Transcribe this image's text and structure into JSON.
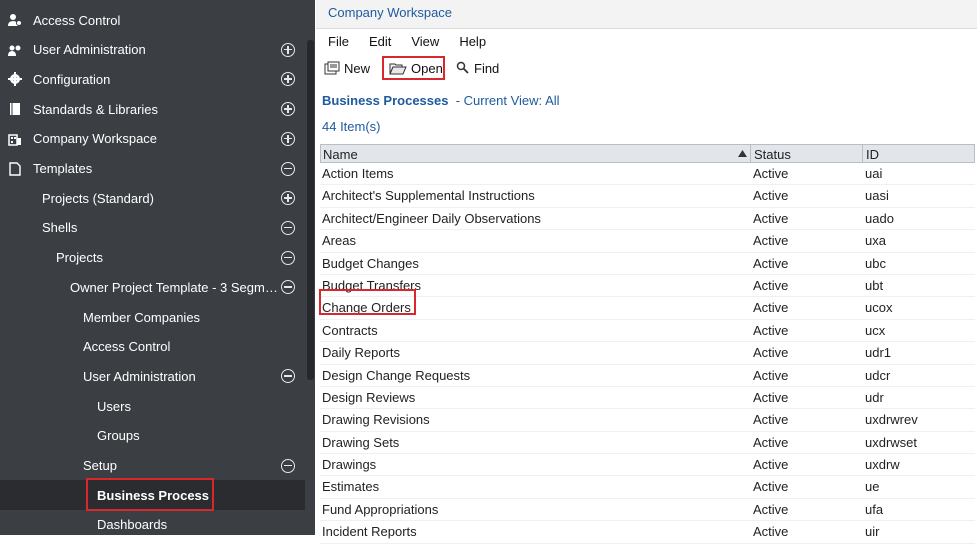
{
  "sidebar": {
    "items": [
      {
        "label": "Access Control",
        "icon": "users-gear-icon",
        "toggle": null
      },
      {
        "label": "User Administration",
        "icon": "users-icon",
        "toggle": "plus"
      },
      {
        "label": "Configuration",
        "icon": "gear-icon",
        "toggle": "plus"
      },
      {
        "label": "Standards & Libraries",
        "icon": "book-icon",
        "toggle": "plus"
      },
      {
        "label": "Company Workspace",
        "icon": "building-icon",
        "toggle": "plus"
      },
      {
        "label": "Templates",
        "icon": "document-icon",
        "toggle": "minus"
      },
      {
        "label": "Projects (Standard)",
        "icon": null,
        "toggle": "plus"
      },
      {
        "label": "Shells",
        "icon": null,
        "toggle": "minus"
      },
      {
        "label": "Projects",
        "icon": null,
        "toggle": "minus"
      },
      {
        "label": "Owner Project Template - 3 Segm…",
        "icon": null,
        "toggle": "minus"
      },
      {
        "label": "Member Companies",
        "icon": null,
        "toggle": null
      },
      {
        "label": "Access Control",
        "icon": null,
        "toggle": null
      },
      {
        "label": "User Administration",
        "icon": null,
        "toggle": "minus"
      },
      {
        "label": "Users",
        "icon": null,
        "toggle": null
      },
      {
        "label": "Groups",
        "icon": null,
        "toggle": null
      },
      {
        "label": "Setup",
        "icon": null,
        "toggle": "minus"
      },
      {
        "label": "Business Process",
        "icon": null,
        "toggle": null
      },
      {
        "label": "Dashboards",
        "icon": null,
        "toggle": null
      }
    ]
  },
  "main": {
    "title": "Company Workspace",
    "menu": [
      "File",
      "Edit",
      "View",
      "Help"
    ],
    "toolbar": {
      "new": "New",
      "open": "Open",
      "find": "Find"
    },
    "heading": "Business Processes",
    "view_label": "- Current View:",
    "view_value": "All",
    "item_count": "44  Item(s)",
    "columns": {
      "name": "Name",
      "status": "Status",
      "id": "ID"
    },
    "rows": [
      {
        "name": "Action Items",
        "status": "Active",
        "id": "uai"
      },
      {
        "name": "Architect's Supplemental Instructions",
        "status": "Active",
        "id": "uasi"
      },
      {
        "name": "Architect/Engineer Daily Observations",
        "status": "Active",
        "id": "uado"
      },
      {
        "name": "Areas",
        "status": "Active",
        "id": "uxa"
      },
      {
        "name": "Budget Changes",
        "status": "Active",
        "id": "ubc"
      },
      {
        "name": "Budget Transfers",
        "status": "Active",
        "id": "ubt"
      },
      {
        "name": "Change Orders",
        "status": "Active",
        "id": "ucox"
      },
      {
        "name": "Contracts",
        "status": "Active",
        "id": "ucx"
      },
      {
        "name": "Daily Reports",
        "status": "Active",
        "id": "udr1"
      },
      {
        "name": "Design Change Requests",
        "status": "Active",
        "id": "udcr"
      },
      {
        "name": "Design Reviews",
        "status": "Active",
        "id": "udr"
      },
      {
        "name": "Drawing Revisions",
        "status": "Active",
        "id": "uxdrwrev"
      },
      {
        "name": "Drawing Sets",
        "status": "Active",
        "id": "uxdrwset"
      },
      {
        "name": "Drawings",
        "status": "Active",
        "id": "uxdrw"
      },
      {
        "name": "Estimates",
        "status": "Active",
        "id": "ue"
      },
      {
        "name": "Fund Appropriations",
        "status": "Active",
        "id": "ufa"
      },
      {
        "name": "Incident Reports",
        "status": "Active",
        "id": "uir"
      }
    ]
  },
  "colors": {
    "sidebar_bg": "#3b3e43",
    "link_blue": "#1f5aa0",
    "highlight_red": "#d9272e"
  }
}
